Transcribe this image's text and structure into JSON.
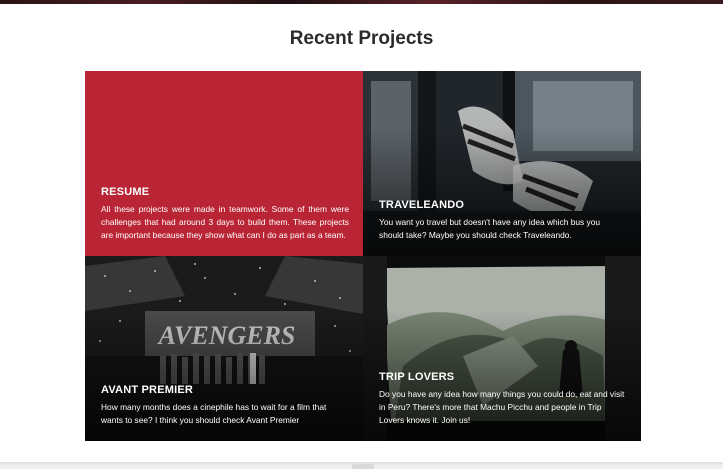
{
  "section": {
    "title": "Recent Projects"
  },
  "projects": [
    {
      "title": "RESUME",
      "description": "All these projects were made in teamwork. Some of them were challenges that had around 3 days to build them. These projects are important because they show what can I do as part as a team.",
      "background": "#b92535"
    },
    {
      "title": "TRAVELEANDO",
      "description": "You want yo travel but doesn't have any idea which bus you should take? Maybe you should check Traveleando.",
      "background": "#1e2226"
    },
    {
      "title": "AVANT PREMIER",
      "description": "How many months does a cinephile has to wait for a film that wants to see? I think you should check Avant Premier",
      "background": "#151515"
    },
    {
      "title": "TRIP LOVERS",
      "description": "Do you have any idea how many things you could do, eat and visit in Peru? There's more that Machu Picchu and people in Trip Lovers knows it. Join us!",
      "background": "#0e0e0e"
    }
  ],
  "colors": {
    "accent": "#b92535",
    "title_text": "#2b2b2b",
    "page_background": "#efefef"
  }
}
